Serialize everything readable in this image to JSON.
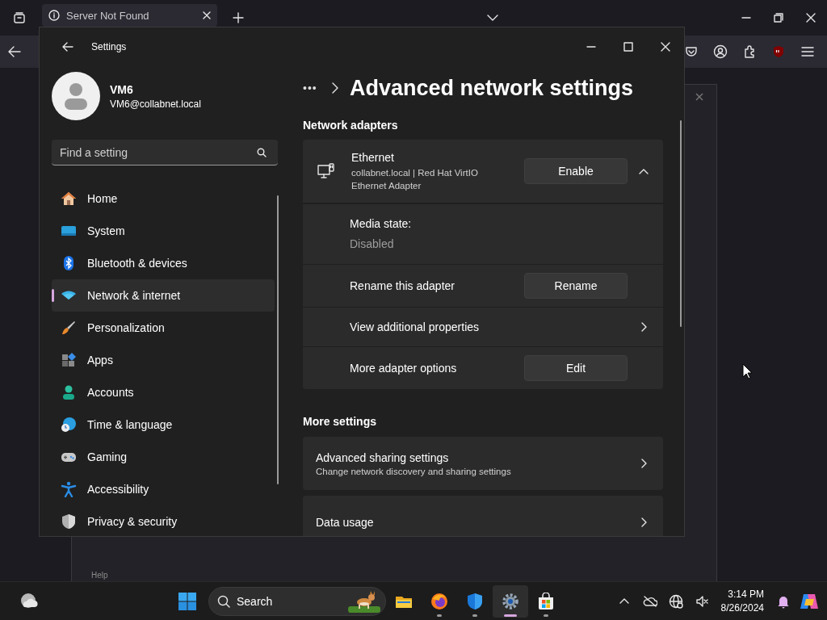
{
  "browser": {
    "tab": {
      "title": "Server Not Found"
    },
    "dialog": {
      "help": "Help"
    }
  },
  "settings": {
    "title": "Settings",
    "user": {
      "name": "VM6",
      "email": "VM6@collabnet.local"
    },
    "search": {
      "placeholder": "Find a setting"
    },
    "nav": [
      {
        "kind": "home",
        "label": "Home",
        "selected": false
      },
      {
        "kind": "system",
        "label": "System",
        "selected": false
      },
      {
        "kind": "bluetooth",
        "label": "Bluetooth & devices",
        "selected": false
      },
      {
        "kind": "network",
        "label": "Network & internet",
        "selected": true
      },
      {
        "kind": "personalization",
        "label": "Personalization",
        "selected": false
      },
      {
        "kind": "apps",
        "label": "Apps",
        "selected": false
      },
      {
        "kind": "accounts",
        "label": "Accounts",
        "selected": false
      },
      {
        "kind": "time",
        "label": "Time & language",
        "selected": false
      },
      {
        "kind": "gaming",
        "label": "Gaming",
        "selected": false
      },
      {
        "kind": "accessibility",
        "label": "Accessibility",
        "selected": false
      },
      {
        "kind": "privacy",
        "label": "Privacy & security",
        "selected": false
      }
    ],
    "breadcrumb": "•••",
    "page_title": "Advanced network settings",
    "sections": [
      {
        "kind": "adapter",
        "heading": "Network adapters",
        "adapter": {
          "name": "Ethernet",
          "description": "collabnet.local | Red Hat VirtIO Ethernet Adapter",
          "action": "Enable",
          "expanded": true,
          "details": [
            {
              "kind": "info",
              "label": "Media state:",
              "value": "Disabled"
            },
            {
              "kind": "button",
              "label": "Rename this adapter",
              "action": "Rename"
            },
            {
              "kind": "link",
              "label": "View additional properties"
            },
            {
              "kind": "button",
              "label": "More adapter options",
              "action": "Edit"
            }
          ]
        }
      },
      {
        "kind": "list",
        "heading": "More settings",
        "rows": [
          {
            "kind": "link",
            "label": "Advanced sharing settings",
            "description": "Change network discovery and sharing settings"
          },
          {
            "kind": "link",
            "label": "Data usage"
          }
        ]
      }
    ]
  },
  "taskbar": {
    "search": {
      "label": "Search"
    },
    "apps": [
      {
        "kind": "files",
        "running": false,
        "selected": false
      },
      {
        "kind": "firefox",
        "running": true,
        "selected": false
      },
      {
        "kind": "defender",
        "running": true,
        "selected": false
      },
      {
        "kind": "settings",
        "running": true,
        "selected": true
      },
      {
        "kind": "store",
        "running": true,
        "selected": false
      }
    ],
    "time": "3:14 PM",
    "date": "8/26/2024"
  }
}
